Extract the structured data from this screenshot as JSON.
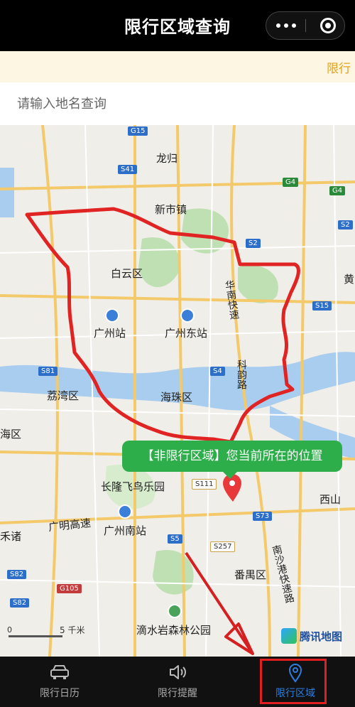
{
  "header": {
    "title": "限行区域查询"
  },
  "notice": {
    "text": "限行"
  },
  "search": {
    "placeholder": "请输入地名查询",
    "value": ""
  },
  "map": {
    "place_labels": [
      "龙归",
      "新市镇",
      "白云区",
      "广州站",
      "广州东站",
      "华南快速",
      "科韵路",
      "荔湾区",
      "海珠区",
      "海区",
      "长隆飞鸟乐园",
      "广明高速",
      "广州南站",
      "禾诸",
      "番禺区",
      "西山",
      "南沙港快速路",
      "滴水岩森林公园",
      "黄"
    ],
    "road_badges": [
      "G15",
      "S41",
      "G4",
      "G4",
      "S2",
      "S2",
      "S15",
      "S81",
      "S4",
      "S111",
      "S73",
      "S5",
      "S257",
      "S82",
      "G105",
      "S82"
    ],
    "bubble_text": "【非限行区域】您当前所在的位置",
    "scale_zero": "0",
    "scale_text": "5 千米",
    "logo_text": "腾讯地图",
    "restricted_line_color": "#e02424",
    "bubble_color": "#2eae4a",
    "marker_color": "#e8383a"
  },
  "tabbar": {
    "tabs": [
      {
        "label": "限行日历",
        "icon": "car-icon"
      },
      {
        "label": "限行提醒",
        "icon": "speaker-icon"
      },
      {
        "label": "限行区域",
        "icon": "location-pin-icon"
      }
    ],
    "active_color": "#2d7de0",
    "highlight_color": "#e02020"
  }
}
